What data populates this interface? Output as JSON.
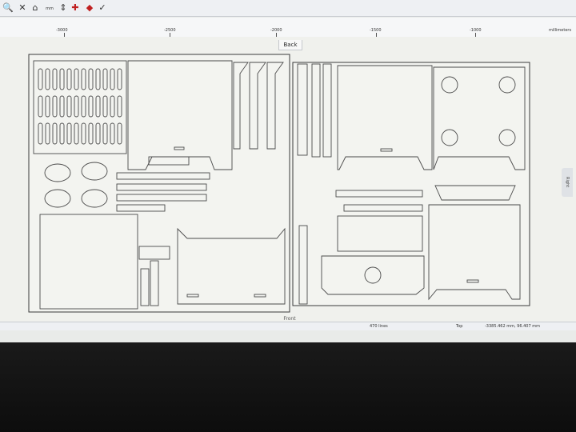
{
  "toolbar": {
    "buttons": [
      {
        "name": "zoom",
        "glyph": "🔍",
        "color": "#2a5fb0"
      },
      {
        "name": "delete",
        "glyph": "✕",
        "color": "#333333"
      },
      {
        "name": "camera",
        "glyph": "⌂",
        "color": "#333333"
      },
      {
        "name": "measure",
        "glyph": "mm",
        "color": "#333333"
      },
      {
        "name": "jog",
        "glyph": "⇕",
        "color": "#333333"
      },
      {
        "name": "origin",
        "glyph": "✚",
        "color": "#c02020"
      },
      {
        "name": "fire",
        "glyph": "◆",
        "color": "#c02020"
      },
      {
        "name": "check",
        "glyph": "✓",
        "color": "#333333"
      }
    ]
  },
  "ruler": {
    "labels": [
      "-3000",
      "-2500",
      "-2000",
      "-1500",
      "-1000",
      "millimeters"
    ]
  },
  "views": {
    "back": "Back",
    "front": "Front",
    "right": "Right"
  },
  "status": {
    "lines": "470 lines",
    "view": "Top",
    "coords": "-3385.462 mm, 96.407 mm"
  },
  "colors": {
    "accent": "#2a5fb0",
    "laser": "#c02020"
  }
}
